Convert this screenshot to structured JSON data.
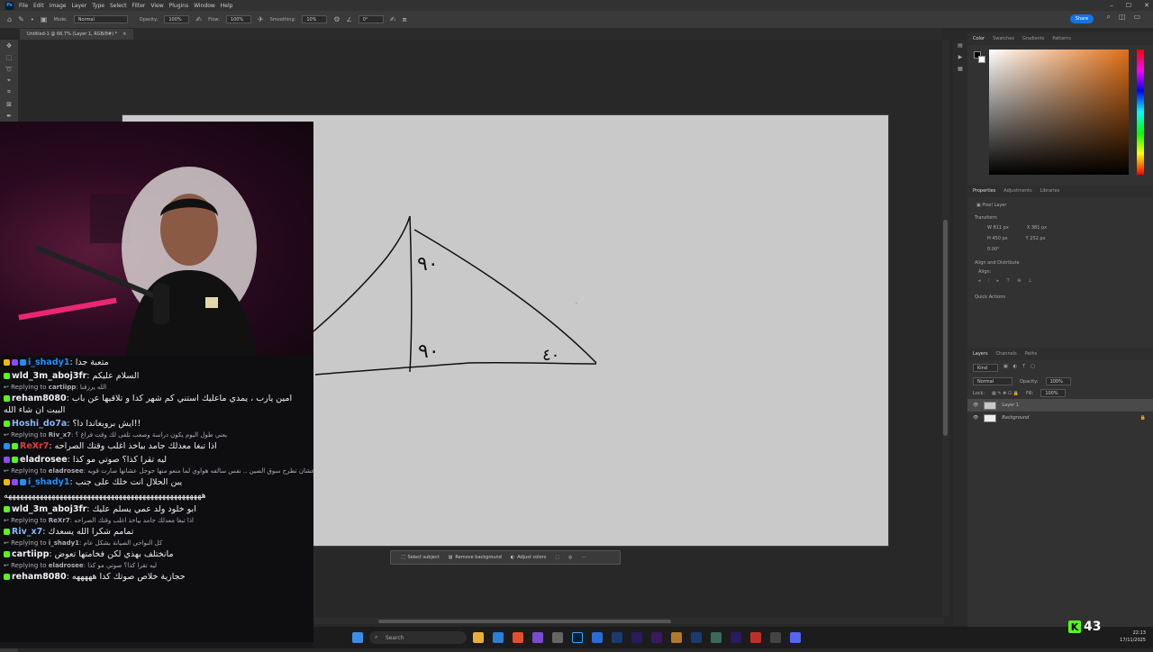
{
  "app": {
    "menu": [
      "File",
      "Edit",
      "Image",
      "Layer",
      "Type",
      "Select",
      "Filter",
      "View",
      "Plugins",
      "Window",
      "Help"
    ],
    "share_label": "Share"
  },
  "options": {
    "mode_label": "Mode:",
    "mode_value": "Normal",
    "opacity_label": "Opacity:",
    "opacity_value": "100%",
    "flow_label": "Flow:",
    "flow_value": "100%",
    "smoothing_label": "Smoothing:",
    "smoothing_value": "10%",
    "angle_value": "0°"
  },
  "document": {
    "tab_title": "Untitled-1 @ 66.7% (Layer 1, RGB/8#) *"
  },
  "canvas_annotations": {
    "angle_top": "٩٠",
    "angle_bottom": "٩٠",
    "angle_right": "٤٠"
  },
  "context_bar": {
    "select_subject": "Select subject",
    "remove_background": "Remove background",
    "adjust_colors": "Adjust colors"
  },
  "color_panel": {
    "tabs": [
      "Color",
      "Swatches",
      "Gradients",
      "Patterns"
    ],
    "fg_color": "#000000",
    "bg_color": "#ffffff",
    "hue_color": "#e06f16"
  },
  "properties": {
    "tabs": [
      "Properties",
      "Adjustments",
      "Libraries"
    ],
    "kind": "Pixel Layer",
    "transform_label": "Transform",
    "w": "W 811 px",
    "h": "H 450 px",
    "x": "X 381 px",
    "y": "Y 252 px",
    "angle": "0.00°",
    "align_label": "Align and Distribute",
    "align_sub": "Align:",
    "quick_actions": "Quick Actions"
  },
  "layers": {
    "tabs": [
      "Layers",
      "Channels",
      "Paths"
    ],
    "kind_filter": "Kind",
    "blend_mode": "Normal",
    "opacity_label": "Opacity:",
    "opacity_value": "100%",
    "lock_label": "Lock:",
    "fill_label": "Fill:",
    "fill_value": "100%",
    "items": [
      {
        "name": "Layer 1"
      },
      {
        "name": "Background"
      }
    ]
  },
  "chat": {
    "messages": [
      {
        "type": "msg",
        "user": "i_shady1",
        "user_color": "#1e90ff",
        "text": "متعبة جدا",
        "badges": [
          "#f5b800",
          "#9147ff",
          "#1e90ff"
        ]
      },
      {
        "type": "msg",
        "user": "wld_3m_aboj3fr",
        "user_color": "#efeff1",
        "text": "السلام عليكم",
        "badges": [
          "#53fc18"
        ]
      },
      {
        "type": "reply",
        "to": "cartiipp",
        "text": "الله يرزقنا"
      },
      {
        "type": "msg2",
        "user": "reham8080",
        "user_color": "#efeff1",
        "text": "امين يارب ، يمدي ماعليك استني كم شهر كدا و تلاقيها عن باب البيت ان شاء الله",
        "badges": [
          "#53fc18"
        ]
      },
      {
        "type": "msg",
        "user": "Hoshi_do7a",
        "user_color": "#8ab4f8",
        "text": "ايش بروبغاندا دا؟!!",
        "badges": [
          "#53fc18"
        ]
      },
      {
        "type": "reply",
        "to": "Riv_x7",
        "text": "يعني طول اليوم يكون دراسة وصعب تلقى لك وقت فراغ ؟"
      },
      {
        "type": "msg",
        "user": "ReXr7",
        "user_color": "#e03a3a",
        "text": "اذا تبغا معدلك جامد بياخذ اغلب وقتك الصراحه",
        "badges": [
          "#1e90ff",
          "#53fc18"
        ]
      },
      {
        "type": "msg",
        "user": "eladrosee",
        "user_color": "#efeff1",
        "text": "ليه تقرا كذا؟ صوتي مو كذا",
        "badges": [
          "#9147ff",
          "#53fc18"
        ]
      },
      {
        "type": "reply",
        "to": "eladrosee",
        "text": "انا ادعم الصين .. ذا كله بروبغاندا من امريكا عشان تطرح سوق الصين .. نفس سالفه هواوي لما منعو منها جوجل عشانها صارت قويه"
      },
      {
        "type": "msg",
        "user": "i_shady1",
        "user_color": "#1e90ff",
        "text": "يبن الحلال انت خلك على جنب",
        "badges": [
          "#f5b800",
          "#9147ff",
          "#1e90ff"
        ]
      },
      {
        "type": "msg",
        "user": "",
        "user_color": "#efeff1",
        "text": "ههههههههههههههههههههههههههههههههههههههههههههههههههه",
        "badges": []
      },
      {
        "type": "msg",
        "user": "wld_3m_aboj3fr",
        "user_color": "#efeff1",
        "text": "ابو خلود ولد عمي يسلم عليك",
        "badges": [
          "#53fc18"
        ]
      },
      {
        "type": "reply",
        "to": "ReXr7",
        "text": "اذا تبغا معدلك جامد بياخذ اغلب وقتك الصراحه"
      },
      {
        "type": "msg",
        "user": "Riv_x7",
        "user_color": "#8ab4f8",
        "text": "تمامم شكرا الله يسعدك",
        "badges": [
          "#53fc18"
        ]
      },
      {
        "type": "reply",
        "to": "i_shady1",
        "text": "كل النواحي الصيانة بشكل عام"
      },
      {
        "type": "msg",
        "user": "cartiipp",
        "user_color": "#efeff1",
        "text": "مانختلف بهذي لكن فخامتها تعوض",
        "badges": [
          "#53fc18"
        ]
      },
      {
        "type": "reply",
        "to": "eladrosee",
        "text": "ليه تقرا كذا؟ صوتي مو كذا"
      },
      {
        "type": "msg",
        "user": "reham8080",
        "user_color": "#efeff1",
        "text": "حجازية خلاص صوتك كدا هههههه",
        "badges": [
          "#53fc18"
        ]
      }
    ],
    "replying_prefix": "Replying to"
  },
  "taskbar": {
    "search_placeholder": "Search",
    "time": "22:13",
    "date": "17/11/2025"
  },
  "stream_overlay": {
    "viewers": "43"
  }
}
